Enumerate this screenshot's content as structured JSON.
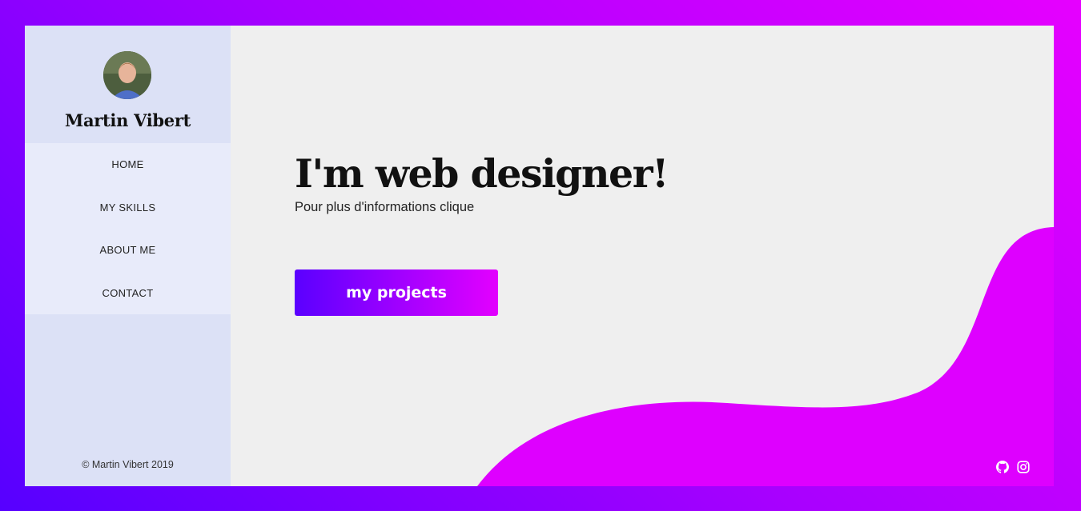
{
  "sidebar": {
    "profile_name": "Martin Vibert",
    "avatar_icon": "user-avatar-photo",
    "nav": [
      {
        "label": "HOME"
      },
      {
        "label": "MY SKILLS"
      },
      {
        "label": "ABOUT ME"
      },
      {
        "label": "CONTACT"
      }
    ],
    "copyright": "© Martin Vibert 2019"
  },
  "hero": {
    "title": "I'm web designer!",
    "subtitle": "Pour plus d'informations clique",
    "cta_label": "my projects"
  },
  "social": {
    "icons": [
      "github-icon",
      "instagram-icon"
    ]
  },
  "colors": {
    "accent_start": "#5a00ff",
    "accent_end": "#e300ff",
    "wave": "#de00ff",
    "sidebar_bg": "#dce1f6",
    "nav_bg": "#e8ebfa",
    "main_bg": "#efefef"
  }
}
